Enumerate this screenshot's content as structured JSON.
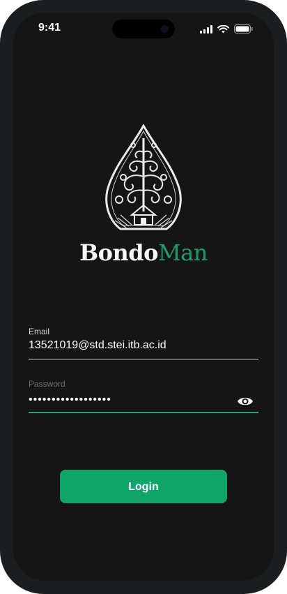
{
  "status_bar": {
    "time": "9:41",
    "icons": [
      "signal-icon",
      "wifi-icon",
      "battery-icon"
    ]
  },
  "brand": {
    "part1": "Bondo",
    "part2": "Man",
    "accent_color": "#1a9e6e"
  },
  "form": {
    "email_label": "Email",
    "email_value": "13521019@std.stei.itb.ac.id",
    "password_label": "Password",
    "password_value": "••••••••••••••••••",
    "login_label": "Login"
  },
  "colors": {
    "background": "#151515",
    "primary": "#0fa56a",
    "text": "#ffffff"
  }
}
